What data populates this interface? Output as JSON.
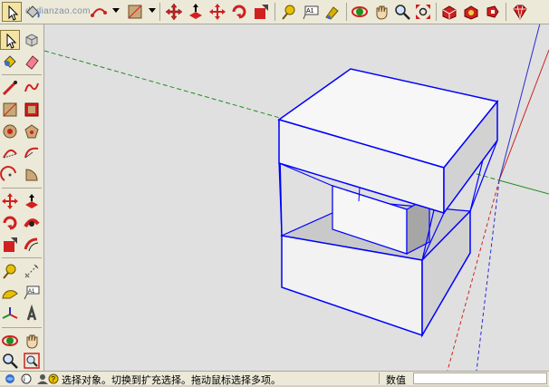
{
  "toolbar": {
    "watermark": "dadianzao.com",
    "tools": [
      {
        "icon": "select-arrow-icon",
        "selected": true
      },
      {
        "icon": "paint-bucket-icon"
      },
      {
        "icon": "arc-icon"
      },
      {
        "icon": "rectangle-icon"
      },
      {
        "icon": "move-icon"
      },
      {
        "icon": "push-pull-icon"
      },
      {
        "icon": "rotate-icon"
      },
      {
        "icon": "follow-me-icon"
      },
      {
        "icon": "offset-icon"
      },
      {
        "icon": "tape-measure-icon"
      },
      {
        "icon": "text-icon"
      },
      {
        "icon": "paint-icon"
      },
      {
        "icon": "orbit-icon"
      },
      {
        "icon": "pan-icon"
      },
      {
        "icon": "zoom-icon"
      },
      {
        "icon": "zoom-extents-icon"
      },
      {
        "icon": "3d-warehouse-icon"
      },
      {
        "icon": "components-icon"
      },
      {
        "icon": "extension-icon"
      },
      {
        "icon": "ruby-icon"
      }
    ]
  },
  "palette": {
    "tools": [
      {
        "icon": "select-arrow-icon",
        "selected": true
      },
      {
        "icon": "make-component-icon"
      },
      {
        "icon": "paint-bucket-icon"
      },
      {
        "icon": "eraser-icon"
      },
      {
        "icon": "line-icon"
      },
      {
        "icon": "freehand-icon"
      },
      {
        "icon": "rectangle-icon"
      },
      {
        "icon": "rotated-rectangle-icon"
      },
      {
        "icon": "circle-icon"
      },
      {
        "icon": "polygon-icon"
      },
      {
        "icon": "arc-icon"
      },
      {
        "icon": "two-point-arc-icon"
      },
      {
        "icon": "three-point-arc-icon"
      },
      {
        "icon": "pie-icon"
      },
      {
        "icon": "move-icon"
      },
      {
        "icon": "push-pull-icon"
      },
      {
        "icon": "rotate-icon"
      },
      {
        "icon": "follow-me-icon"
      },
      {
        "icon": "scale-icon"
      },
      {
        "icon": "offset-icon"
      },
      {
        "icon": "tape-measure-icon"
      },
      {
        "icon": "dimension-icon"
      },
      {
        "icon": "protractor-icon"
      },
      {
        "icon": "text-icon"
      },
      {
        "icon": "axes-icon"
      },
      {
        "icon": "3d-text-icon"
      },
      {
        "icon": "orbit-icon"
      },
      {
        "icon": "pan-icon"
      },
      {
        "icon": "zoom-icon"
      },
      {
        "icon": "zoom-window-icon"
      }
    ]
  },
  "status": {
    "message": "选择对象。切换到扩充选择。拖动鼠标选择多项。",
    "measurements_label": "数值",
    "measurements_value": ""
  },
  "colors": {
    "selection": "#0000ff",
    "red_axis": "#cc2222",
    "green_axis": "#1f8f1f",
    "blue_axis": "#2a2ad0",
    "background": "#e0e0e0"
  }
}
